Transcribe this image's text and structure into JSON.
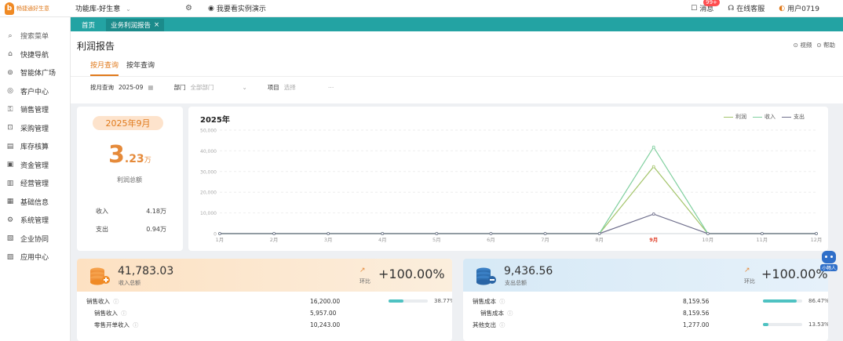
{
  "brand": {
    "logo_text": "畅捷通好生意"
  },
  "topbar": {
    "library": "功能库-好生意",
    "demo_label": "我要看实例演示",
    "messages_label": "消息",
    "messages_badge": "99+",
    "service_label": "在线客服",
    "user_label": "用户0719"
  },
  "sidebar": {
    "search_label": "搜索菜单",
    "items": [
      {
        "label": "快捷导航",
        "icon": "home-icon"
      },
      {
        "label": "智能体广场",
        "icon": "ai-icon"
      },
      {
        "label": "客户中心",
        "icon": "user-icon"
      },
      {
        "label": "销售管理",
        "icon": "sales-icon"
      },
      {
        "label": "采购管理",
        "icon": "purchase-icon"
      },
      {
        "label": "库存核算",
        "icon": "inventory-icon"
      },
      {
        "label": "资金管理",
        "icon": "funds-icon"
      },
      {
        "label": "经营管理",
        "icon": "operations-icon"
      },
      {
        "label": "基础信息",
        "icon": "info-icon"
      },
      {
        "label": "系统管理",
        "icon": "system-icon"
      },
      {
        "label": "企业协同",
        "icon": "collab-icon"
      },
      {
        "label": "应用中心",
        "icon": "apps-icon"
      }
    ]
  },
  "tabs": {
    "home": "首页",
    "active": "业务利润报告"
  },
  "page": {
    "title": "利润报告",
    "help_items": [
      "视频",
      "帮助"
    ],
    "subtabs": [
      "按月查询",
      "按年查询"
    ],
    "filters": {
      "month_label": "按月查询",
      "month_value": "2025-09",
      "dept_label": "部门",
      "dept_placeholder": "全部部门",
      "project_label": "项目",
      "project_placeholder": "选择"
    }
  },
  "profit_card": {
    "month": "2025年9月",
    "value_big": "3",
    "value_small": ".23",
    "unit": "万",
    "label": "利润总额",
    "income_label": "收入",
    "income_value": "4.18万",
    "expense_label": "支出",
    "expense_value": "0.94万"
  },
  "chart_data": {
    "type": "line",
    "title": "2025年",
    "categories": [
      "1月",
      "2月",
      "3月",
      "4月",
      "5月",
      "6月",
      "7月",
      "8月",
      "9月",
      "10月",
      "11月",
      "12月"
    ],
    "highlight_category": "9月",
    "ylim": [
      0,
      50000
    ],
    "yticks": [
      "0",
      "10,000",
      "20,000",
      "30,000",
      "40,000",
      "50,000"
    ],
    "series": [
      {
        "name": "利润",
        "color": "#a3c46a",
        "values": [
          0,
          0,
          0,
          0,
          0,
          0,
          0,
          0,
          32347,
          0,
          0,
          0
        ]
      },
      {
        "name": "收入",
        "color": "#7fcf9e",
        "values": [
          0,
          0,
          0,
          0,
          0,
          0,
          0,
          0,
          41783,
          0,
          0,
          0
        ]
      },
      {
        "name": "支出",
        "color": "#6f6f8c",
        "values": [
          0,
          0,
          0,
          0,
          0,
          0,
          0,
          0,
          9437,
          0,
          0,
          0
        ]
      }
    ],
    "legend_position": "top-right",
    "grid": true
  },
  "income_summary": {
    "value": "41,783.03",
    "label": "收入总额",
    "compare_label": "环比",
    "compare_value": "+100.00%",
    "rows": [
      {
        "name": "销售收入",
        "amount": "16,200.00",
        "pct": "38.77%",
        "fraction": 0.3877,
        "level": 0
      },
      {
        "name": "销售收入",
        "amount": "5,957.00",
        "level": 1
      },
      {
        "name": "零售开单收入",
        "amount": "10,243.00",
        "level": 1
      }
    ]
  },
  "expense_summary": {
    "value": "9,436.56",
    "label": "支出总额",
    "compare_label": "环比",
    "compare_value": "+100.00%",
    "rows": [
      {
        "name": "销售成本",
        "amount": "8,159.56",
        "pct": "86.47%",
        "fraction": 0.8647,
        "level": 0
      },
      {
        "name": "销售成本",
        "amount": "8,159.56",
        "level": 1
      },
      {
        "name": "其他支出",
        "amount": "1,277.00",
        "pct": "13.53%",
        "fraction": 0.1353,
        "level": 0
      }
    ]
  },
  "robot_label": "小畅人"
}
